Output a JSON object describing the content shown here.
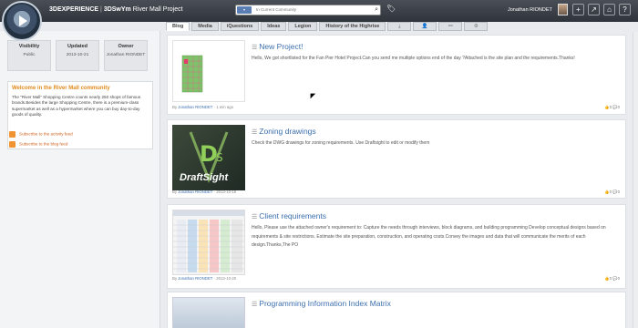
{
  "header": {
    "brand": "3DEXPERIENCE",
    "separator": "|",
    "app": "3DSwYm",
    "project": "River Mall Project",
    "search_placeholder": "In Current Community",
    "search_scope": "",
    "user_name": "Jonathan RIONDET",
    "buttons": [
      "plus-icon",
      "share-icon",
      "home-icon",
      "help-icon"
    ]
  },
  "tabs": [
    "Blog",
    "Media",
    "iQuestions",
    "Ideas",
    "Legion",
    "History of the Highrise",
    "⤓",
    "👤",
    "⚯",
    "⚙"
  ],
  "active_tab": "Blog",
  "left": {
    "stats": [
      {
        "key": "Visibility",
        "value": "Public"
      },
      {
        "key": "Updated",
        "value": "2013-10-21"
      },
      {
        "key": "Owner",
        "value": "Jonathan RIONDET"
      }
    ],
    "welcome_title": "Welcome in the River Mall community",
    "welcome_body": "The \"River Mall\" Shopping Centre counts nearly 250 shops of famous brands.Besides the large Shopping Centre, there is a premium-class supermarket as well as a hypermarket where you can buy day-to-day goods of quality.",
    "feed_activity": "Subscribe to the activity feed",
    "feed_blog": "Subscribe to the blog feed"
  },
  "posts": [
    {
      "title": "New Project!",
      "body": "Hello, We got shortlisted for the Fan Pier Hotel Project.Can you send me multiple options end of the day ?Attached is the site plan and the requirements.Thanks!",
      "by": "By",
      "author": "Jonathan RIONDET",
      "date": "1 min ago",
      "likes": "0",
      "comments": "0"
    },
    {
      "title": "Zoning drawings",
      "body": "Check the DWG drawings for zoning requirements. Use Draftsight to edit or modify them",
      "by": "By",
      "author": "Jonathan RIONDET",
      "date": "2013-10-16",
      "likes": "0",
      "comments": "0",
      "thumb_label": "DraftSight"
    },
    {
      "title": "Client requirements",
      "body": "Hello, Please use the attached owner's requirement to: Capture the needs through interviews, block diagrams, and building programming Develop conceptual designs based on requirements & site restrictions. Estimate the site preparation, construction, and operating costs.Convey the images and data that will communicate the merits of each design.Thanks,The PO",
      "by": "By",
      "author": "Jonathan RIONDET",
      "date": "2013-10-20",
      "likes": "0",
      "comments": "0"
    },
    {
      "title": "Programming Information Index Matrix"
    }
  ]
}
